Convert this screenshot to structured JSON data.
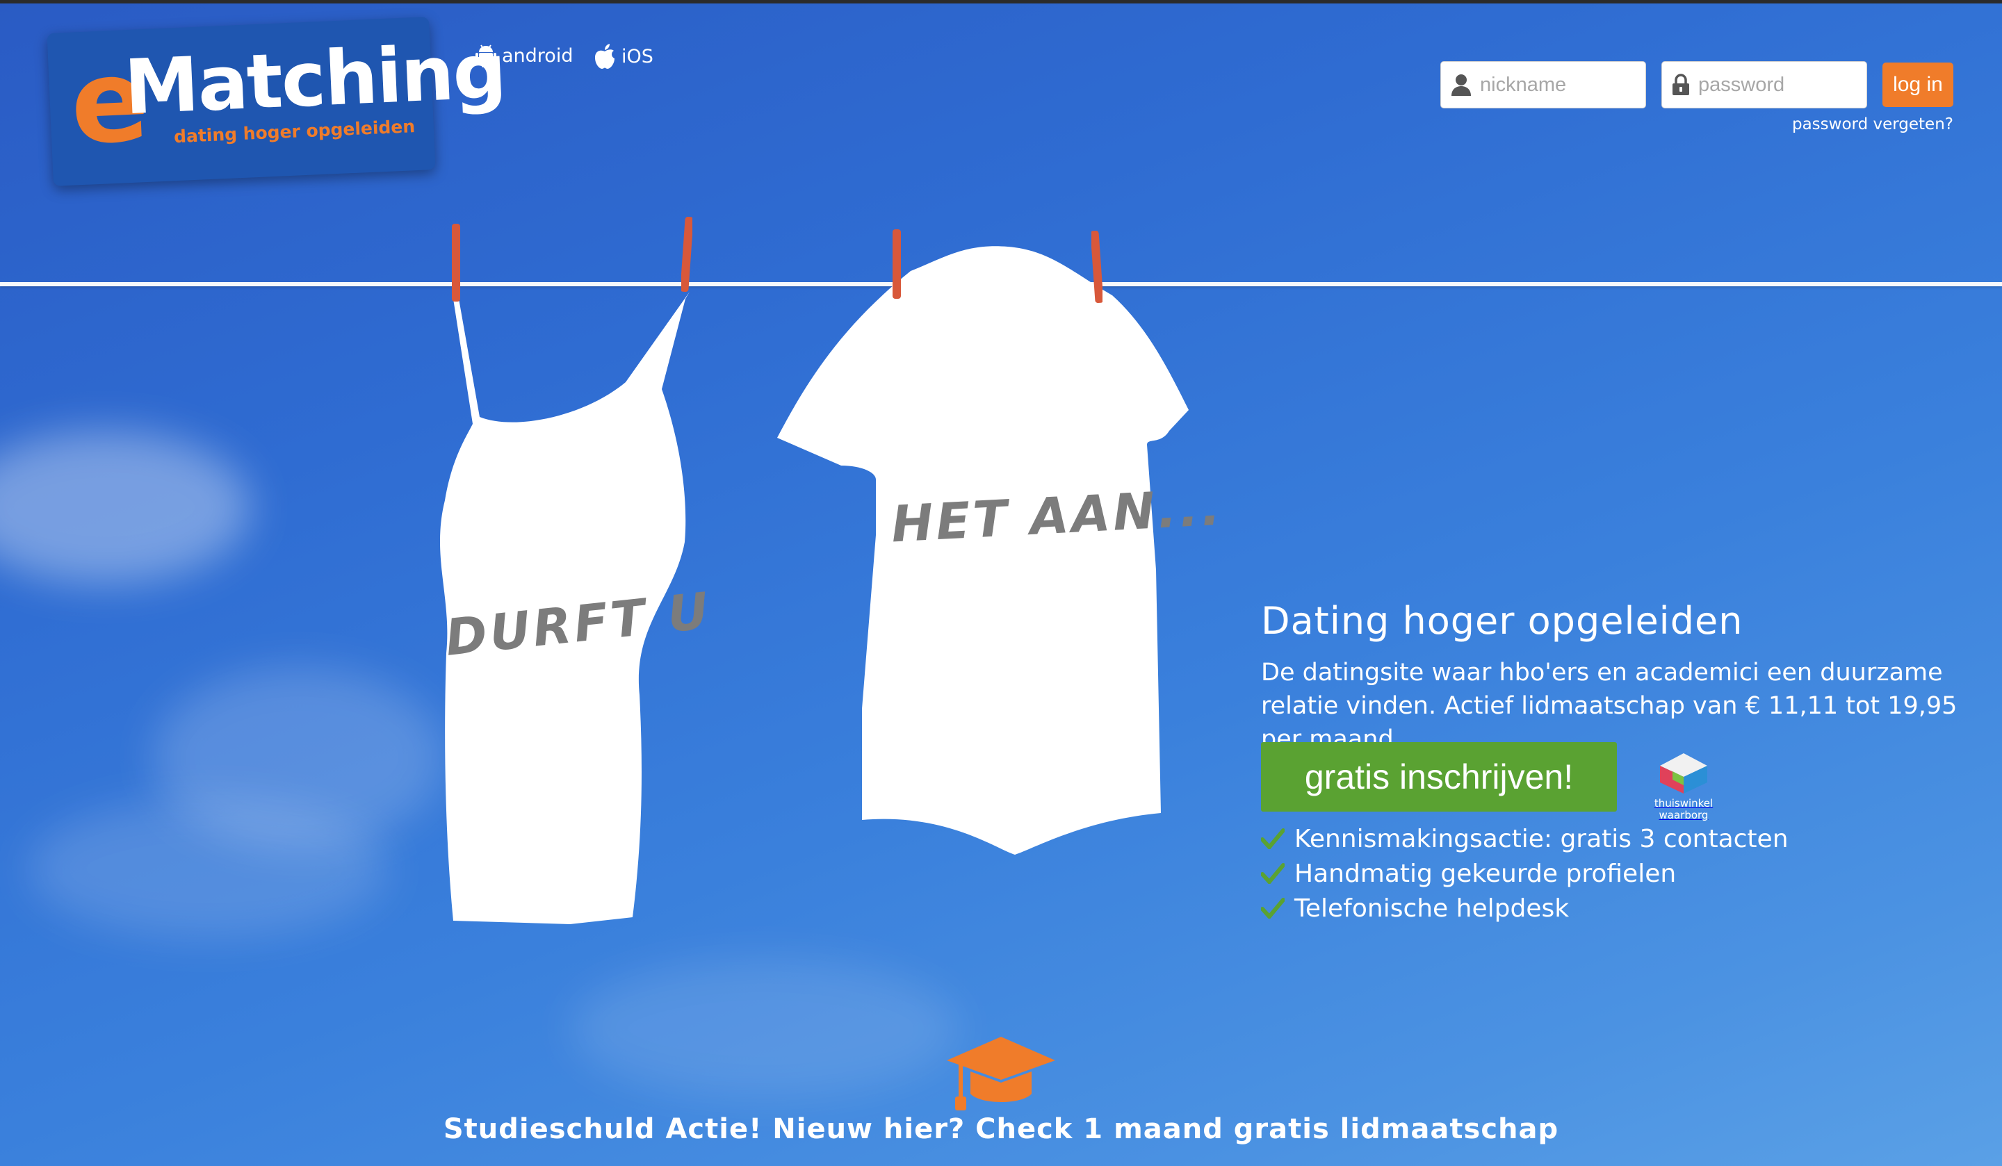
{
  "logo": {
    "letter": "e",
    "word": "Matching",
    "tagline": "dating hoger opgeleiden"
  },
  "apps": {
    "android_label": "android",
    "ios_label": "iOS"
  },
  "login": {
    "nickname_placeholder": "nickname",
    "password_placeholder": "password",
    "button_label": "log in",
    "forgot_label": "password vergeten?"
  },
  "hero": {
    "tanktop_text": "DURFT U",
    "tshirt_text": "HET AAN..."
  },
  "promo": {
    "title": "Dating hoger opgeleiden",
    "description": "De datingsite waar hbo'ers en academici een duurzame relatie vinden. Actief lidmaatschap van € 11,11 tot 19,95 per maand.",
    "cta_label": "gratis inschrijven!",
    "badge_line1": "thuiswinkel",
    "badge_line2": "waarborg",
    "features": [
      "Kennismakingsactie: gratis 3 contacten",
      "Handmatig gekeurde profielen",
      "Telefonische helpdesk"
    ]
  },
  "bottom": {
    "text": "Studieschuld Actie! Nieuw hier? Check 1 maand gratis lidmaatschap"
  },
  "colors": {
    "accent": "#f07c2a",
    "cta": "#5aa232",
    "logo_bg": "#1f56b0",
    "sky": "#2f6cd2"
  },
  "icons": [
    "android-icon",
    "apple-icon",
    "user-icon",
    "lock-icon",
    "check-icon",
    "graduation-cap-icon",
    "thuiswinkel-icon"
  ]
}
